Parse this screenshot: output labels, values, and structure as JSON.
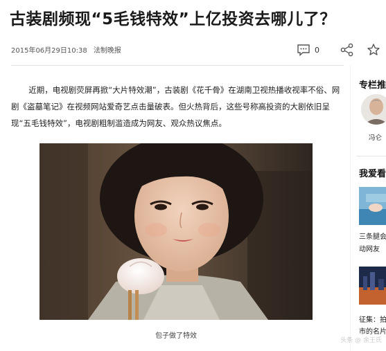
{
  "article": {
    "headline": "古装剧频现“5毛钱特效”上亿投资去哪儿了？",
    "date": "2015年06月29日10:38",
    "source": "法制晚报",
    "comment_count": "0",
    "paragraph": "近期，电视剧荧屏再掀“大片特效潮”，古装剧《花千骨》在湖南卫视热播收视率不俗、网剧《盗墓笔记》在视频网站爱奇艺点击量破表。但火热背后，这些号称高投资的大剧依旧呈现“五毛钱特效”，电视剧粗制滥造成为网友、观众热议焦点。",
    "image_caption": "包子做了特效"
  },
  "toolbar": {
    "comment_icon": "comment-icon",
    "share_icon": "share-icon",
    "favorite_icon": "star-icon"
  },
  "sidebar": {
    "column_title": "专栏推",
    "author_name": "冯仑",
    "recommend_title": "我爱看",
    "item1_line1": "三条腿会",
    "item1_line2": "动网友",
    "item2_line1": "征集：拍",
    "item2_line2": "市的名片"
  },
  "watermark": "头条 @ 余王氏"
}
